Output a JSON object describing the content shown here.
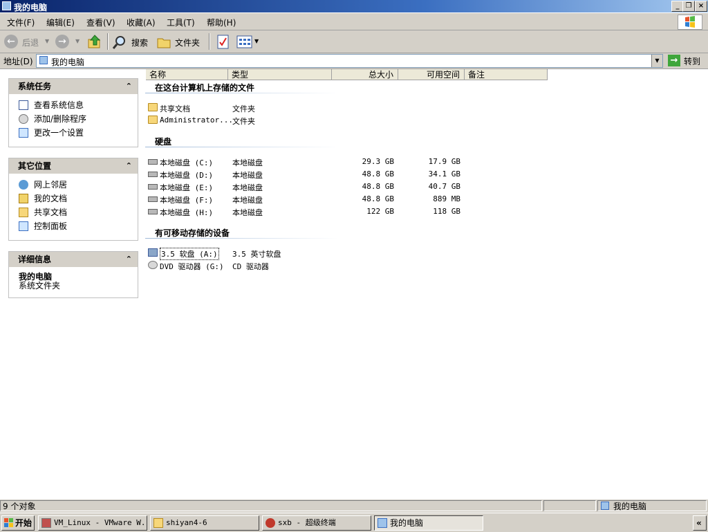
{
  "window": {
    "title": "我的电脑"
  },
  "menu": [
    "文件(F)",
    "编辑(E)",
    "查看(V)",
    "收藏(A)",
    "工具(T)",
    "帮助(H)"
  ],
  "toolbar": {
    "back": "后退",
    "search": "搜索",
    "folders": "文件夹"
  },
  "address": {
    "label": "地址(D)",
    "value": "我的电脑",
    "go": "转到"
  },
  "left": {
    "system_tasks": {
      "title": "系统任务",
      "items": [
        "查看系统信息",
        "添加/删除程序",
        "更改一个设置"
      ]
    },
    "other_places": {
      "title": "其它位置",
      "items": [
        "网上邻居",
        "我的文档",
        "共享文档",
        "控制面板"
      ]
    },
    "details": {
      "title": "详细信息",
      "name": "我的电脑",
      "desc": "系统文件夹"
    }
  },
  "columns": [
    "名称",
    "类型",
    "总大小",
    "可用空间",
    "备注"
  ],
  "groups": {
    "stored": {
      "title": "在这台计算机上存储的文件",
      "rows": [
        {
          "name": "共享文档",
          "type": "文件夹",
          "total": "",
          "free": ""
        },
        {
          "name": "Administrator...",
          "type": "文件夹",
          "total": "",
          "free": ""
        }
      ]
    },
    "hdd": {
      "title": "硬盘",
      "rows": [
        {
          "name": "本地磁盘 (C:)",
          "type": "本地磁盘",
          "total": "29.3 GB",
          "free": "17.9 GB"
        },
        {
          "name": "本地磁盘 (D:)",
          "type": "本地磁盘",
          "total": "48.8 GB",
          "free": "34.1 GB"
        },
        {
          "name": "本地磁盘 (E:)",
          "type": "本地磁盘",
          "total": "48.8 GB",
          "free": "40.7 GB"
        },
        {
          "name": "本地磁盘 (F:)",
          "type": "本地磁盘",
          "total": "48.8 GB",
          "free": "889 MB"
        },
        {
          "name": "本地磁盘 (H:)",
          "type": "本地磁盘",
          "total": "122 GB",
          "free": "118 GB"
        }
      ]
    },
    "removable": {
      "title": "有可移动存储的设备",
      "rows": [
        {
          "name": "3.5 软盘 (A:)",
          "type": "3.5 英寸软盘",
          "total": "",
          "free": ""
        },
        {
          "name": "DVD 驱动器 (G:)",
          "type": "CD 驱动器",
          "total": "",
          "free": ""
        }
      ]
    }
  },
  "status": {
    "count": "9 个对象",
    "location": "我的电脑"
  },
  "taskbar": {
    "start": "开始",
    "tasks": [
      "VM_Linux - VMware W...",
      "shiyan4-6",
      "sxb - 超级终端",
      "我的电脑"
    ],
    "expand": "«"
  }
}
